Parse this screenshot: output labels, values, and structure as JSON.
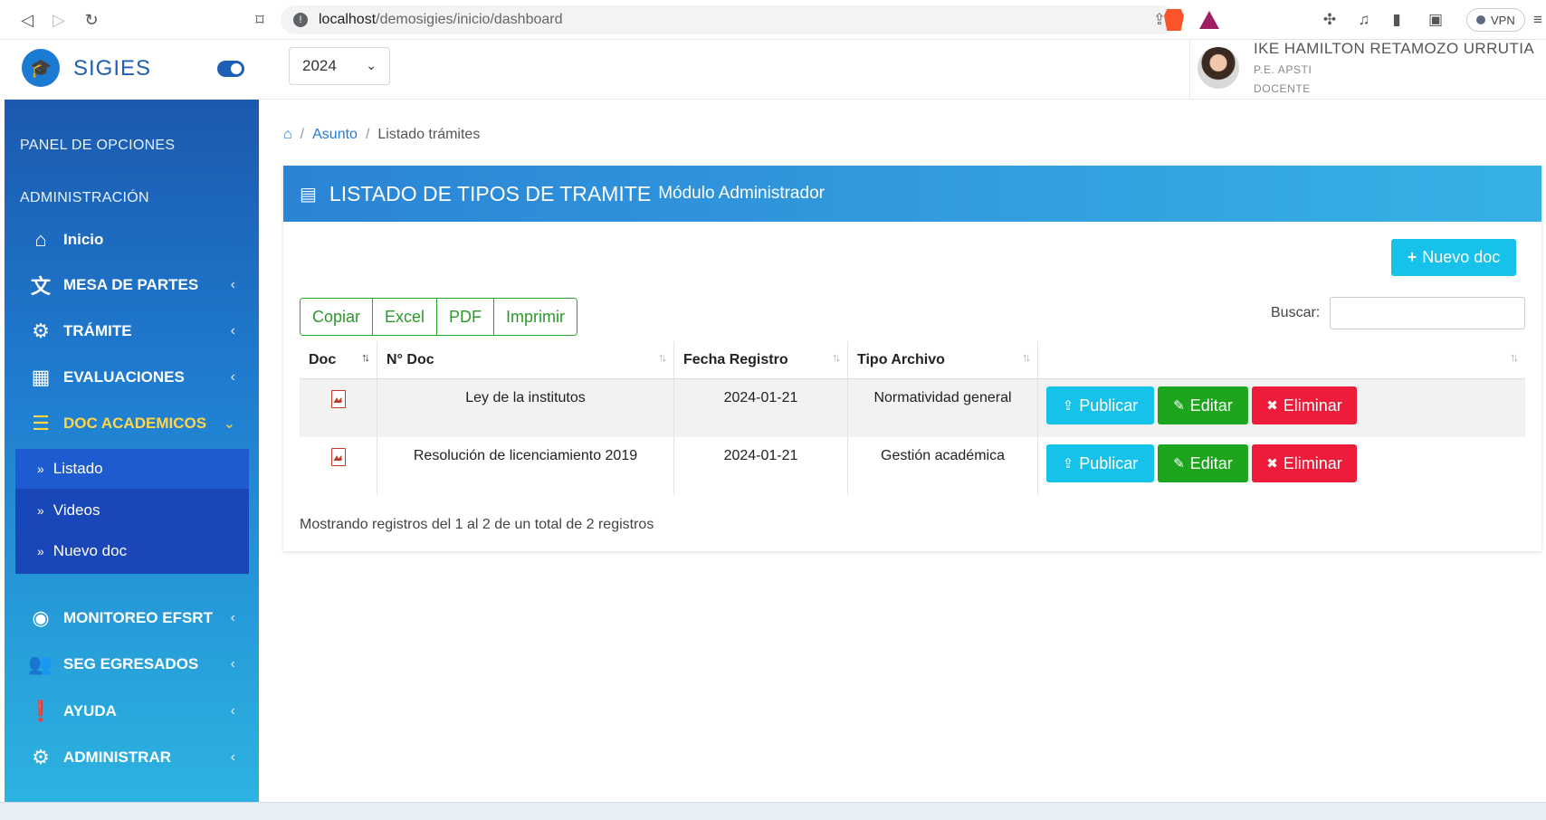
{
  "browser": {
    "url_host": "localhost",
    "url_path": "/demosigies/inicio/dashboard",
    "vpn_label": "VPN"
  },
  "brand": {
    "name": "SIGIES"
  },
  "topbar": {
    "year": "2024",
    "user": {
      "name": "IKE HAMILTON RETAMOZO URRUTIA",
      "org": "P.E. APSTI",
      "role": "DOCENTE"
    }
  },
  "sidebar": {
    "header_panel": "PANEL DE OPCIONES",
    "header_admin": "ADMINISTRACIÓN",
    "items": [
      {
        "label": "Inicio",
        "icon": "home-icon"
      },
      {
        "label": "MESA DE PARTES",
        "icon": "translate-icon"
      },
      {
        "label": "TRÁMITE",
        "icon": "gears-icon"
      },
      {
        "label": "EVALUACIONES",
        "icon": "calendar-icon"
      },
      {
        "label": "DOC ACADEMICOS",
        "icon": "database-icon"
      },
      {
        "label": "MONITOREO EFSRT",
        "icon": "eye-icon"
      },
      {
        "label": "SEG EGRESADOS",
        "icon": "users-icon"
      },
      {
        "label": "AYUDA",
        "icon": "exclamation-icon"
      },
      {
        "label": "ADMINISTRAR",
        "icon": "gear-icon"
      }
    ],
    "submenu": [
      {
        "label": "Listado"
      },
      {
        "label": "Videos"
      },
      {
        "label": "Nuevo doc"
      }
    ]
  },
  "breadcrumb": {
    "link": "Asunto",
    "current": "Listado trámites"
  },
  "card": {
    "title": "LISTADO DE TIPOS DE TRAMITE",
    "subtitle": "Módulo Administrador",
    "new_button": "Nuevo doc",
    "export_buttons": [
      "Copiar",
      "Excel",
      "PDF",
      "Imprimir"
    ],
    "search_label": "Buscar:",
    "search_value": "",
    "columns": [
      "Doc",
      "N° Doc",
      "Fecha Registro",
      "Tipo Archivo",
      ""
    ],
    "rows": [
      {
        "doc_icon": "pdf-icon",
        "n_doc": "Ley de la institutos",
        "fecha": "2024-01-21",
        "tipo": "Normatividad general"
      },
      {
        "doc_icon": "pdf-icon",
        "n_doc": "Resolución de licenciamiento 2019",
        "fecha": "2024-01-21",
        "tipo": "Gestión académica"
      }
    ],
    "actions": {
      "publicar": "Publicar",
      "editar": "Editar",
      "eliminar": "Eliminar"
    },
    "info": "Mostrando registros del 1 al 2 de un total de 2 registros"
  },
  "colors": {
    "sidebar_top": "#1a52a8",
    "sidebar_bottom": "#2cb3e0",
    "active_menu": "#ffd54a",
    "publicar": "#17c2ea",
    "editar": "#1ea51e",
    "eliminar": "#ee1c3a",
    "export_green": "#2a9a2a"
  }
}
